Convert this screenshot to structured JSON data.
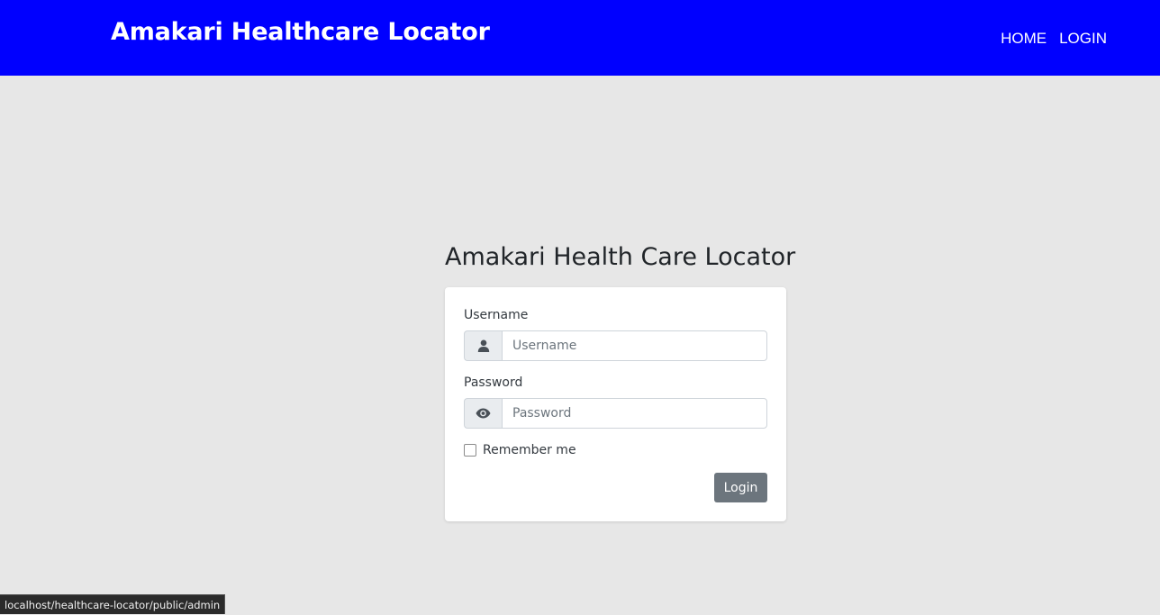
{
  "navbar": {
    "brand": "Amakari Healthcare Locator",
    "links": [
      "HOME",
      "LOGIN"
    ],
    "background_color": "#0000ff"
  },
  "login": {
    "title": "Amakari Health Care Locator",
    "username_label": "Username",
    "username_placeholder": "Username",
    "username_icon": "user-icon",
    "password_label": "Password",
    "password_placeholder": "Password",
    "password_icon": "eye-icon",
    "remember_label": "Remember me",
    "remember_checked": false,
    "submit_label": "Login",
    "button_color": "#6c757d"
  },
  "status_bar": {
    "url": "localhost/healthcare-locator/public/admin"
  }
}
